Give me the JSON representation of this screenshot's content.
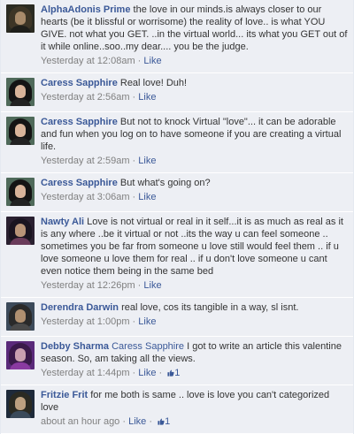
{
  "colors": {
    "link": "#3b5998",
    "row_bg": "#edeff4",
    "meta": "#808080"
  },
  "comments": [
    {
      "author": "AlphaAdonis Prime",
      "mention": "",
      "text": "the love in our minds.is always closer to our hearts (be it blissful or worrisome) the reality of love.. is what YOU GIVE. not what you GET. ..in the virtual world... its what you GET out of it while online..soo..my dear.... you be the judge.",
      "time": "Yesterday at 12:08am",
      "sep": " · ",
      "like_label": "Like",
      "like_count": "",
      "avatar_colors": {
        "bg": "#2b2b22",
        "hair": "#3d3526",
        "face": "#a88a6a",
        "body": "#1e1e1a"
      }
    },
    {
      "author": "Caress Sapphire",
      "mention": "",
      "text": "Real love! Duh!",
      "time": "Yesterday at 2:56am",
      "sep": " · ",
      "like_label": "Like",
      "like_count": "",
      "avatar_colors": {
        "bg": "#4f6a5a",
        "hair": "#141414",
        "face": "#d8b49a",
        "body": "#222222"
      }
    },
    {
      "author": "Caress Sapphire",
      "mention": "",
      "text": "But not to knock Virtual \"love\"... it can be adorable and fun when you log on to have someone if you are creating a virtual life.",
      "time": "Yesterday at 2:59am",
      "sep": " · ",
      "like_label": "Like",
      "like_count": "",
      "avatar_colors": {
        "bg": "#4f6a5a",
        "hair": "#141414",
        "face": "#d8b49a",
        "body": "#222222"
      }
    },
    {
      "author": "Caress Sapphire",
      "mention": "",
      "text": "But what's going on?",
      "time": "Yesterday at 3:06am",
      "sep": " · ",
      "like_label": "Like",
      "like_count": "",
      "avatar_colors": {
        "bg": "#4f6a5a",
        "hair": "#141414",
        "face": "#d8b49a",
        "body": "#222222"
      }
    },
    {
      "author": "Nawty Ali",
      "mention": "",
      "text": "Love is not virtual or real in it self...it is as much as real as it is any where ..be it virtual or not ..its the way u can feel someone .. sometimes you be far from someone u love still would feel them .. if u love someone u love them for real .. if u don't love someone u cant even notice them being in the same bed",
      "time": "Yesterday at 12:26pm",
      "sep": " · ",
      "like_label": "Like",
      "like_count": "",
      "avatar_colors": {
        "bg": "#2a2030",
        "hair": "#1a1420",
        "face": "#b89478",
        "body": "#6a3b5a"
      }
    },
    {
      "author": "Derendra Darwin",
      "mention": "",
      "text": "real love, cos its tangible in a way, sl isnt.",
      "time": "Yesterday at 1:00pm",
      "sep": " · ",
      "like_label": "Like",
      "like_count": "",
      "avatar_colors": {
        "bg": "#3c4a5a",
        "hair": "#2a2a2a",
        "face": "#b09070",
        "body": "#4a4a4a"
      }
    },
    {
      "author": "Debby Sharma",
      "mention": "Caress Sapphire",
      "text": "I got to write an article this valentine season. So, am taking all the views.",
      "time": "Yesterday at 1:44pm",
      "sep": " · ",
      "like_label": "Like",
      "like_count": "1",
      "avatar_colors": {
        "bg": "#5a2a7a",
        "hair": "#3a1a4a",
        "face": "#c9a0b0",
        "body": "#8a3aa0"
      }
    },
    {
      "author": "Fritzie Frit",
      "mention": "",
      "text": "for me both is same .. love is love you can't categorized love",
      "time": "about an hour ago",
      "sep": " · ",
      "like_label": "Like",
      "like_count": "1",
      "avatar_colors": {
        "bg": "#1e2a3a",
        "hair": "#2a2a22",
        "face": "#bca080",
        "body": "#3a4a5a"
      }
    }
  ]
}
